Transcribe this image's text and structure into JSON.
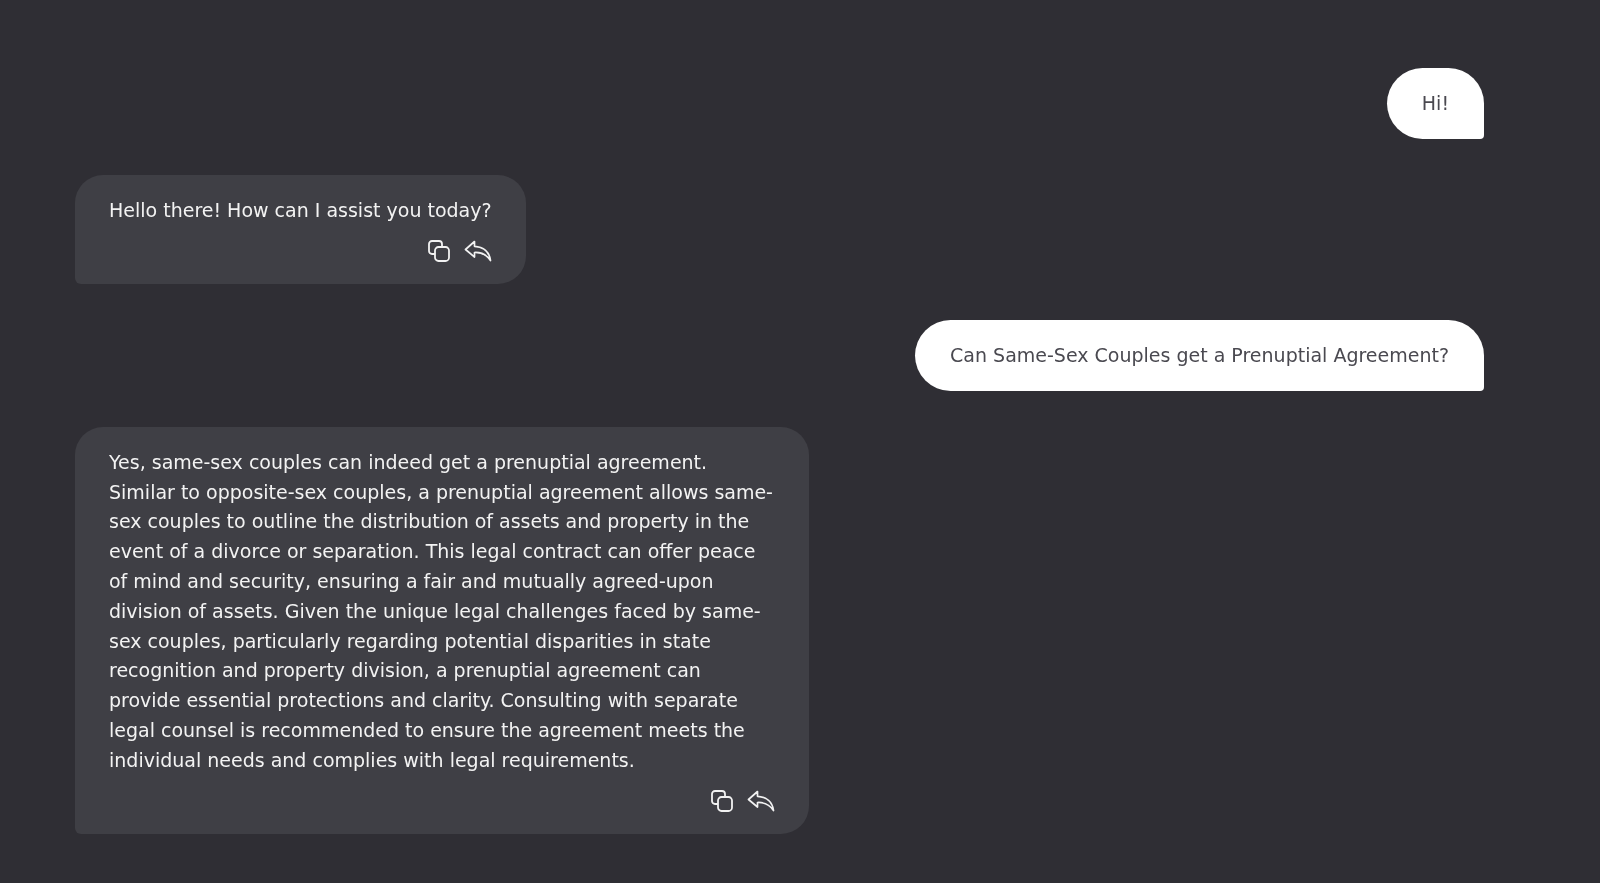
{
  "messages": [
    {
      "kind": "user",
      "text": "Hi!"
    },
    {
      "kind": "assistant",
      "text": "Hello there! How can I assist you today?"
    },
    {
      "kind": "user",
      "text": "Can Same-Sex Couples get a Prenuptial Agreement?"
    },
    {
      "kind": "assistant",
      "text": "Yes, same-sex couples can indeed get a prenuptial agreement. Similar to opposite-sex couples, a prenuptial agreement allows same-sex couples to outline the distribution of assets and property in the event of a divorce or separation. This legal contract can offer peace of mind and security, ensuring a fair and mutually agreed-upon division of assets. Given the unique legal challenges faced by same-sex couples, particularly regarding potential disparities in state recognition and property division, a prenuptial agreement can provide essential protections and clarity. Consulting with separate legal counsel is recommended to ensure the agreement meets the individual needs and complies with legal requirements."
    }
  ]
}
